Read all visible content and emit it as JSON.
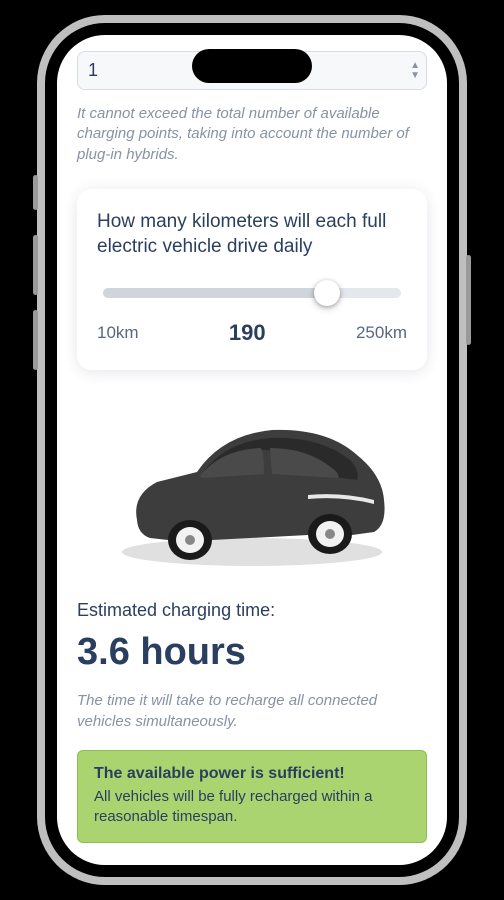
{
  "input": {
    "value": "1"
  },
  "hint": "It cannot exceed the total number of available charging points, taking into account the number of plug-in hybrids.",
  "slider": {
    "question": "How many kilometers will each full electric vehicle drive daily",
    "min_label": "10km",
    "value": "190",
    "max_label": "250km"
  },
  "result": {
    "label": "Estimated charging time:",
    "value": "3.6 hours",
    "caption": "The time it will take to recharge all connected vehicles simultaneously."
  },
  "success": {
    "title": "The available power is sufficient!",
    "body": "All vehicles will be fully recharged within a reasonable timespan."
  }
}
